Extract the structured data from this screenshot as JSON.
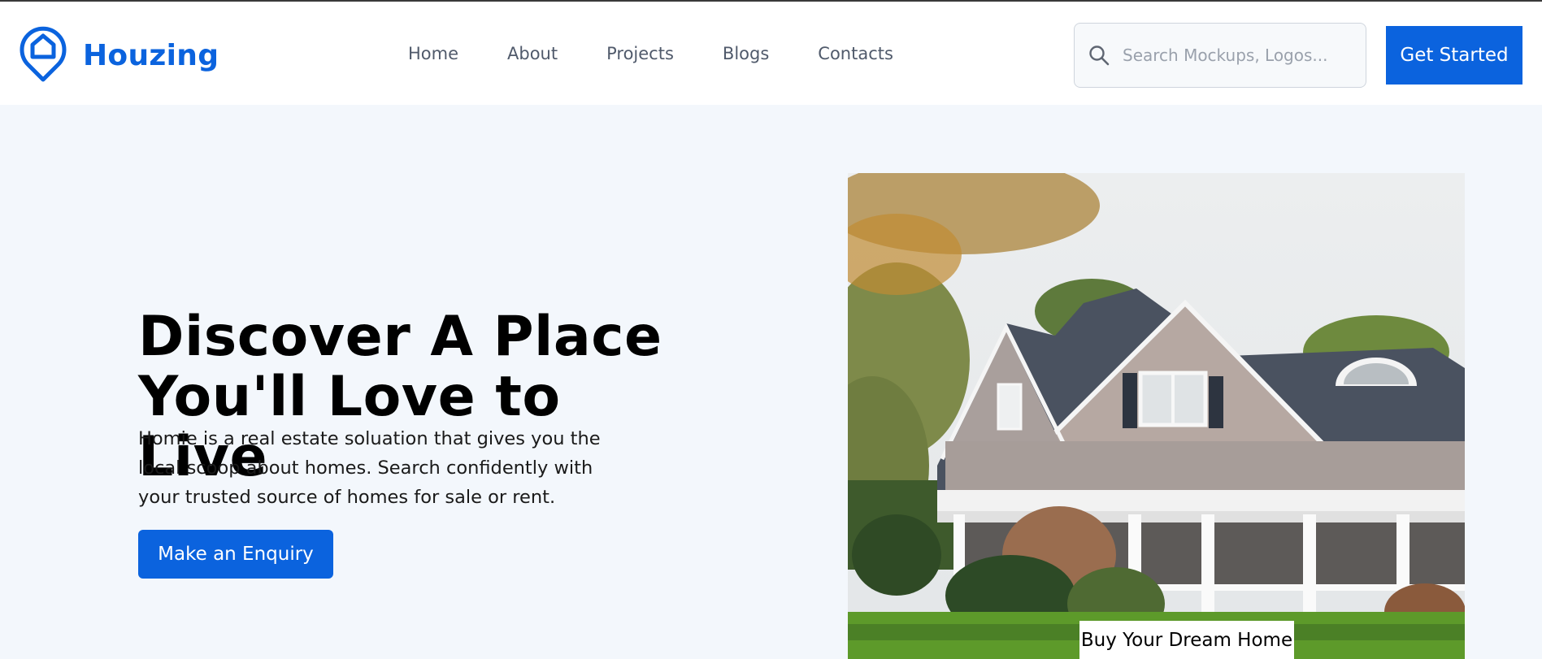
{
  "brand": {
    "name": "Houzing",
    "color": "#0b63de"
  },
  "nav": {
    "items": [
      {
        "label": "Home"
      },
      {
        "label": "About"
      },
      {
        "label": "Projects"
      },
      {
        "label": "Blogs"
      },
      {
        "label": "Contacts"
      }
    ]
  },
  "search": {
    "placeholder": "Search Mockups, Logos...",
    "icon": "search-icon"
  },
  "header_cta": {
    "label": "Get Started"
  },
  "hero": {
    "title_line1": "Discover A Place",
    "title_line2": "You'll Love to Live",
    "subtitle": "Homie is a real estate soluation that gives you the local scoop about homes. Search confidently with your trusted source of homes for sale or rent.",
    "button_label": "Make an Enquiry",
    "image_caption": "Buy Your Dream Home"
  },
  "colors": {
    "accent": "#0b63de",
    "background": "#f3f7fc",
    "nav_text": "#505a6b"
  }
}
